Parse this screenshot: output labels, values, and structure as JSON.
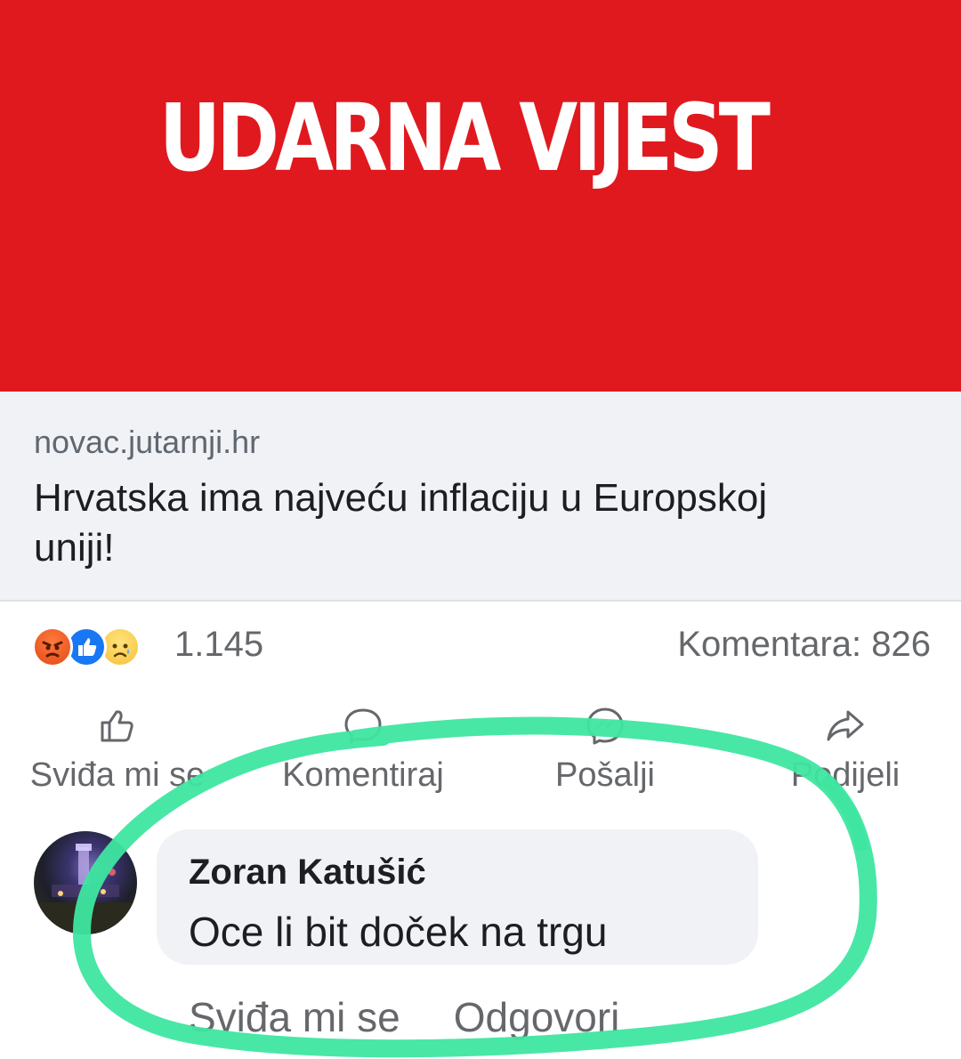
{
  "banner": {
    "title": "UDARNA VIJEST",
    "color": "#e0191f"
  },
  "link_preview": {
    "domain": "novac.jutarnji.hr",
    "headline": "Hrvatska ima najveću inflaciju u Europskoj uniji!"
  },
  "reactions": {
    "icons": [
      "angry-reaction-icon",
      "like-reaction-icon",
      "sad-reaction-icon"
    ],
    "count": "1.145",
    "comments": "Komentara: 826"
  },
  "actions": {
    "like": "Sviđa mi se",
    "comment": "Komentiraj",
    "send": "Pošalji",
    "share": "Podijeli"
  },
  "comment": {
    "author": "Zoran Katušić",
    "text": "Oce li bit doček na trgu",
    "like_label": "Sviđa mi se",
    "reply_label": "Odgovori"
  },
  "colors": {
    "highlight": "#3ee6a0",
    "muted_text": "#65676b",
    "link_bg": "#f0f2f5"
  }
}
